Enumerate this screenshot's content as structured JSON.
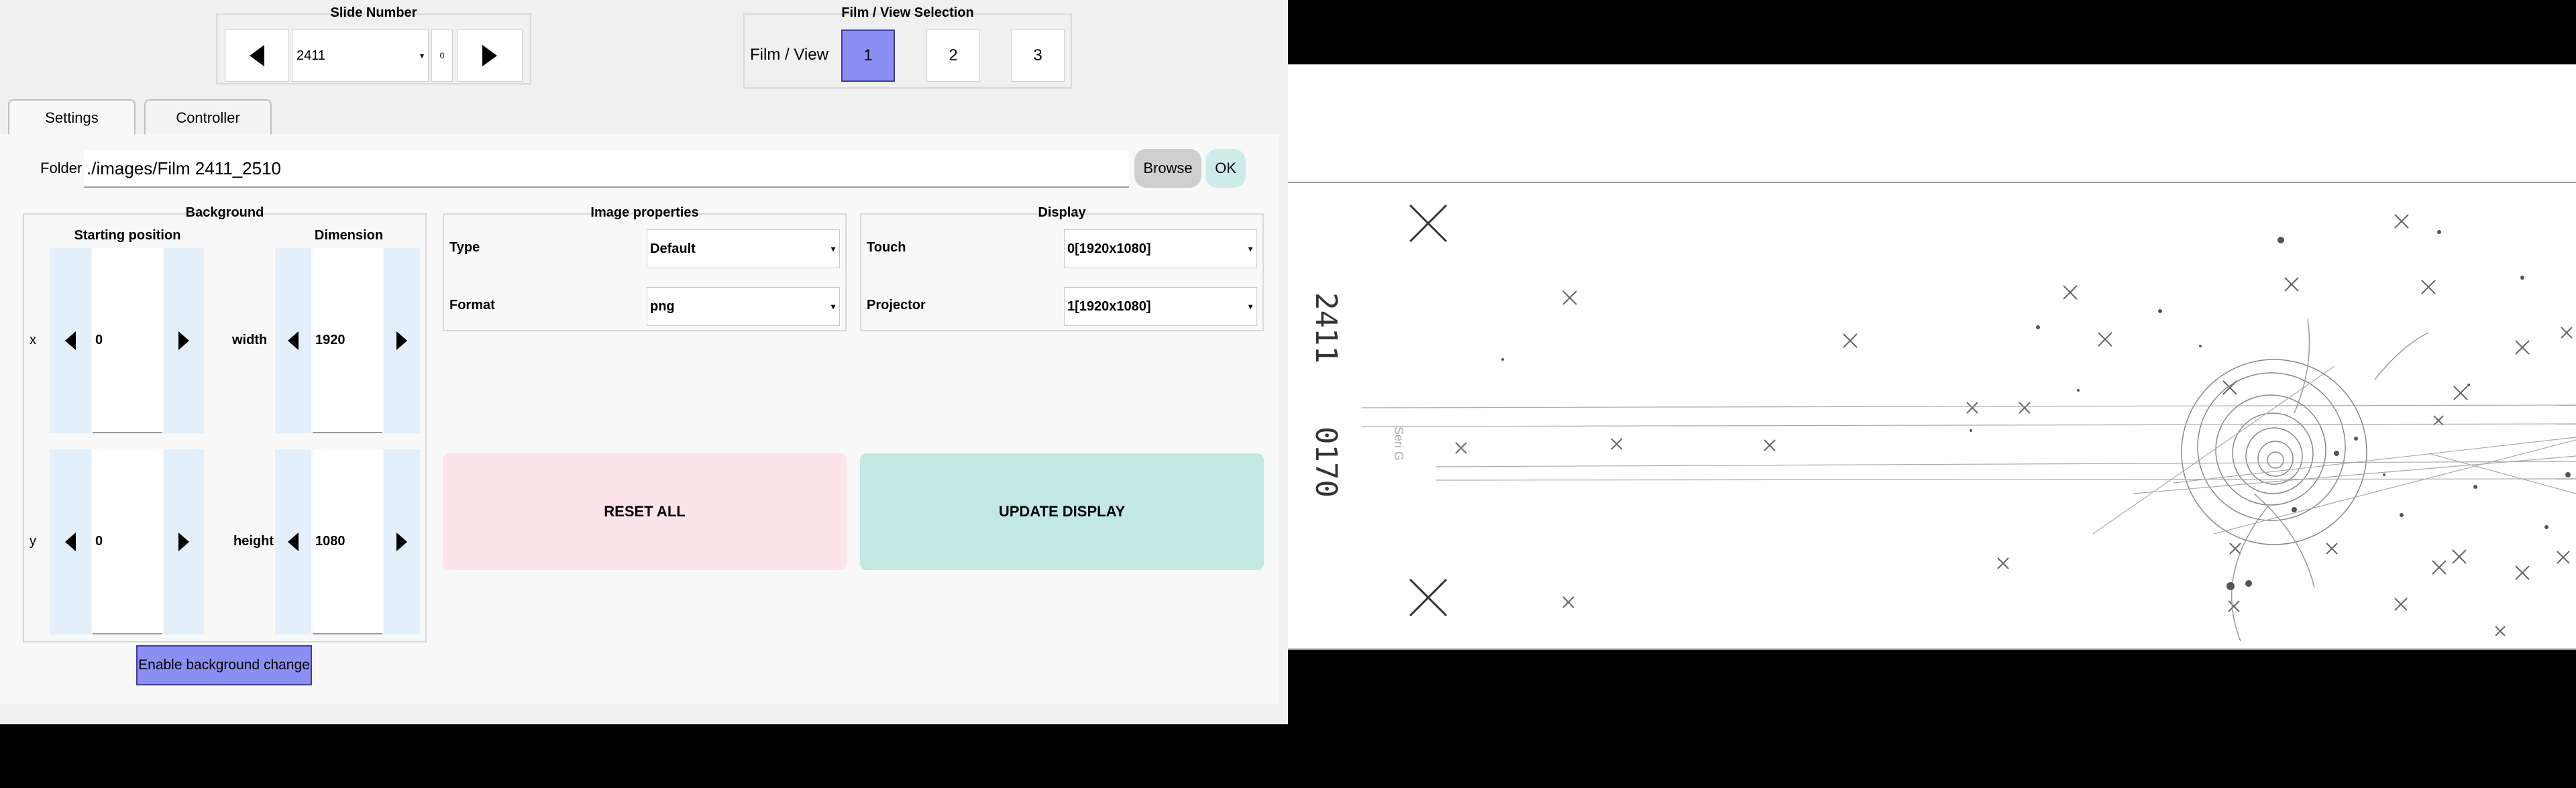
{
  "slide": {
    "title": "Slide Number",
    "value": "2411",
    "side_value": "0"
  },
  "film_view": {
    "title": "Film / View Selection",
    "label": "Film / View",
    "options": [
      "1",
      "2",
      "3"
    ],
    "selected": "1"
  },
  "tabs": [
    {
      "label": "Settings",
      "active": true
    },
    {
      "label": "Controller",
      "active": false
    }
  ],
  "folder": {
    "label": "Folder",
    "path": "./images/Film 2411_2510",
    "browse_label": "Browse",
    "ok_label": "OK"
  },
  "background": {
    "title": "Background",
    "starting_position_title": "Starting position",
    "dimension_title": "Dimension",
    "x_label": "x",
    "x_value": "0",
    "y_label": "y",
    "y_value": "0",
    "width_label": "width",
    "width_value": "1920",
    "height_label": "height",
    "height_value": "1080",
    "enable_button_label": "Enable background change"
  },
  "image_properties": {
    "title": "Image properties",
    "type_label": "Type",
    "type_value": "Default",
    "format_label": "Format",
    "format_value": "png"
  },
  "display": {
    "title": "Display",
    "touch_label": "Touch",
    "touch_value": "0[1920x1080]",
    "projector_label": "Projector",
    "projector_value": "1[1920x1080]"
  },
  "actions": {
    "reset_label": "RESET ALL",
    "update_label": "UPDATE DISPLAY"
  },
  "viewer": {
    "film_number": "2411",
    "sub_number": "0170",
    "seri_mark": "Seri G"
  },
  "colors": {
    "accent_selected": "#8c8ff2",
    "ok_button": "#cdece9",
    "browse_button": "#cfcfcf",
    "reset_button": "#fde3ea",
    "update_button": "#c2e8e3",
    "spin_arrow_bg": "#e3f0fb",
    "window_bg": "#f0f0f0"
  }
}
